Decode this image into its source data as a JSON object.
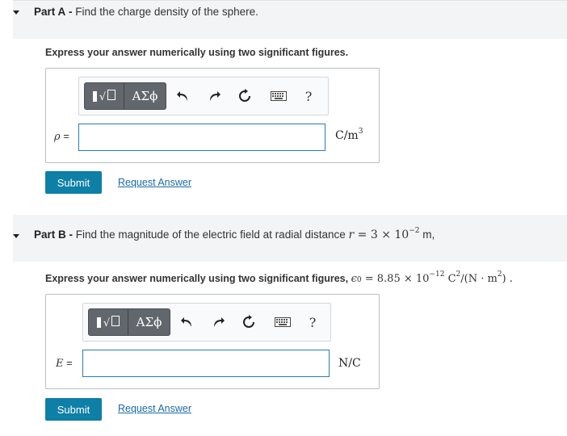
{
  "part_a": {
    "label": "Part A",
    "separator": "-",
    "question": "Find the charge density of the sphere.",
    "instruction": "Express your answer numerically using two significant figures.",
    "toolbar": {
      "greek": "ΑΣϕ",
      "help": "?"
    },
    "variable": "ρ",
    "equals": "=",
    "unit_base": "C/m",
    "unit_exp": "3",
    "submit": "Submit",
    "request": "Request Answer"
  },
  "part_b": {
    "label": "Part B",
    "separator": "-",
    "question_prefix": "Find the magnitude of the electric field at radial distance",
    "r_var": "r",
    "r_eq": "= 3 × 10",
    "r_exp": "−2",
    "r_unit": "m,",
    "instruction_prefix": "Express your answer numerically using two significant figures,",
    "eps_sym": "ϵ",
    "eps_sub": "0",
    "eps_val": "= 8.85 × 10",
    "eps_exp": "−12",
    "eps_unit1": "C",
    "eps_unit1_exp": "2",
    "eps_unit2": "/(N · m",
    "eps_unit2_exp": "2",
    "eps_unit3": ") .",
    "toolbar": {
      "greek": "ΑΣϕ",
      "help": "?"
    },
    "variable": "E",
    "equals": "=",
    "unit": "N/C",
    "submit": "Submit",
    "request": "Request Answer"
  },
  "icons": [
    "caret-down-icon",
    "templates-icon",
    "undo-icon",
    "redo-icon",
    "reset-icon",
    "keyboard-icon",
    "help-icon"
  ],
  "colors": {
    "submit_bg": "#0e7fa6",
    "link": "#1a6aa8",
    "input_border": "#2a7bb7",
    "header_bg": "#f3f4f5"
  }
}
